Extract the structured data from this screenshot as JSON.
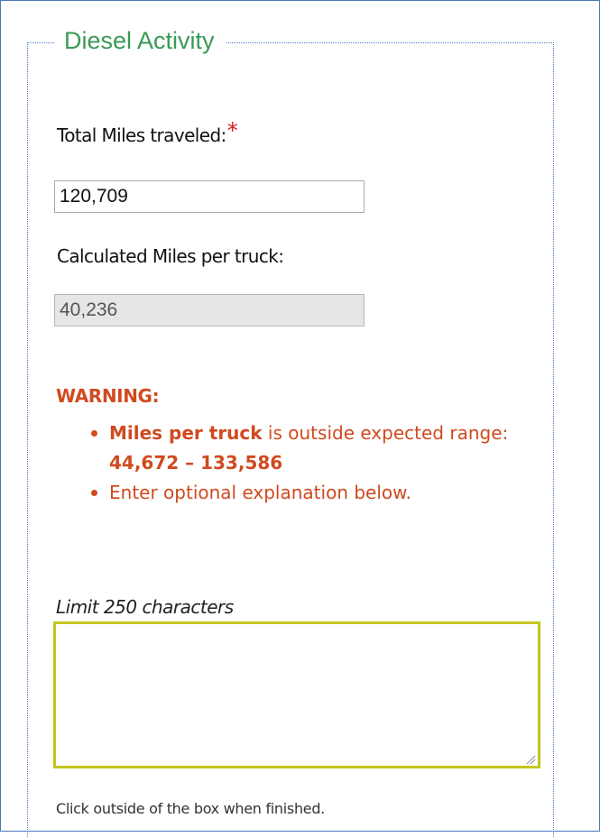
{
  "section": {
    "legend": "Diesel Activity"
  },
  "total_miles": {
    "label": "Total Miles traveled:",
    "required_mark": "*",
    "value": "120,709"
  },
  "calculated_miles": {
    "label": "Calculated Miles per truck:",
    "value": "40,236"
  },
  "warning": {
    "title": "WARNING:",
    "item1_bold": "Miles per truck",
    "item1_text": " is outside expected range: ",
    "item1_range": "44,672 – 133,586",
    "item2_text": "Enter optional explanation below."
  },
  "explanation": {
    "limit_label": "Limit 250 characters",
    "value": "",
    "hint": "Click outside of the box when finished."
  },
  "colors": {
    "legend": "#3a9a55",
    "warning": "#d04a1f",
    "required": "#d11c1c",
    "textarea_border": "#c3c61f",
    "frame_border": "#4a77b8"
  }
}
